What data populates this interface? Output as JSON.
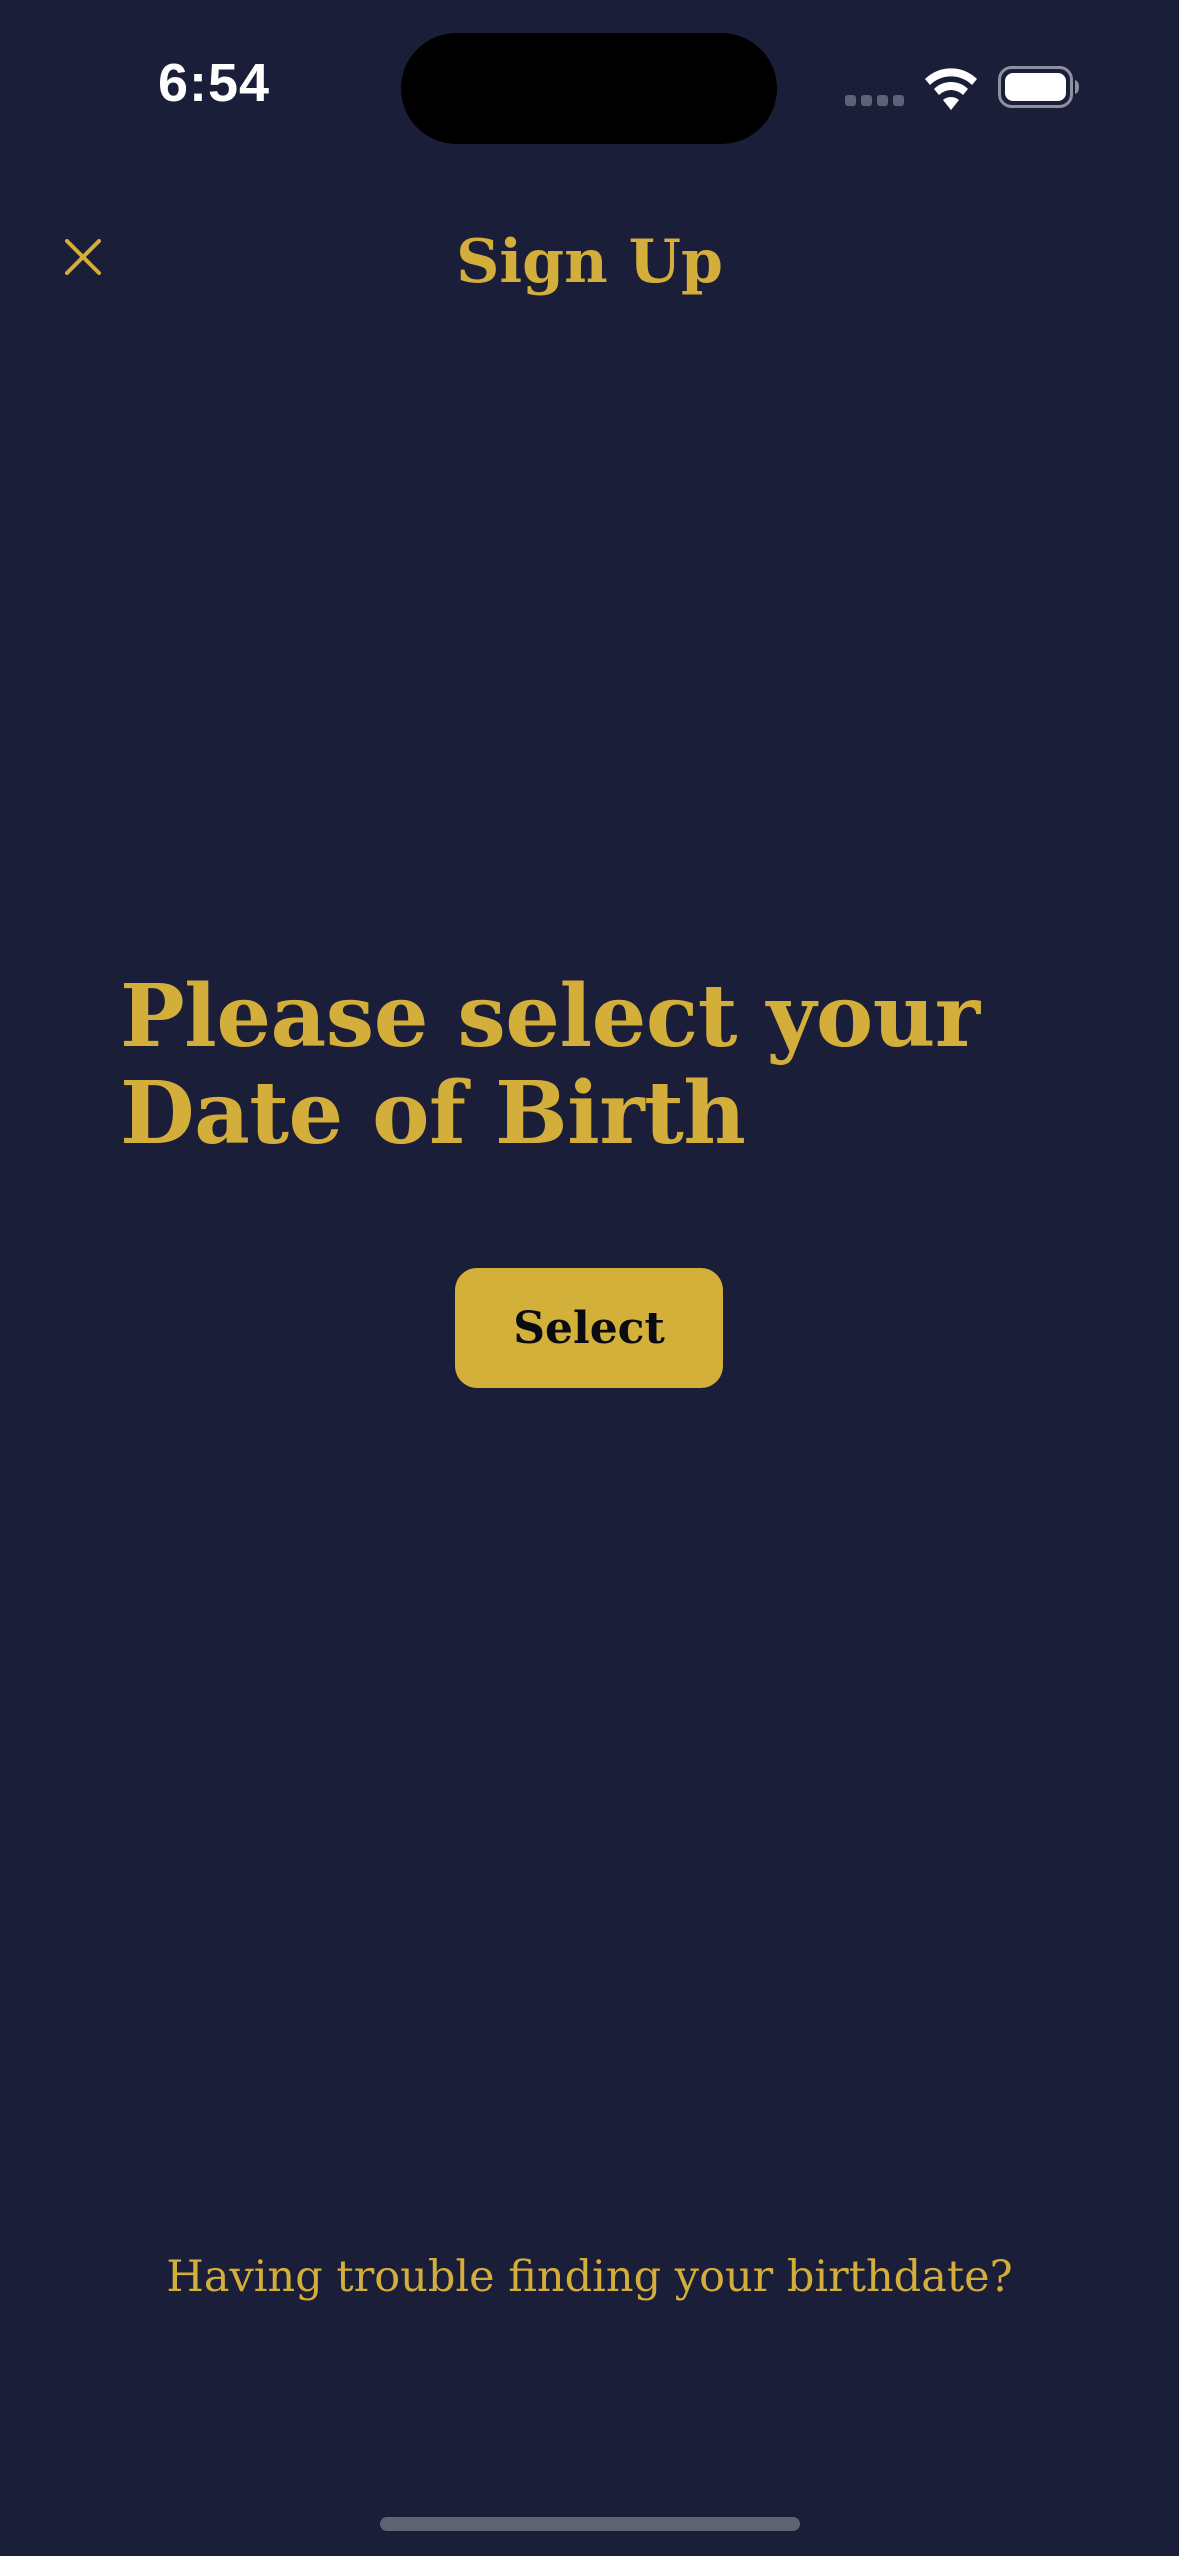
{
  "status_bar": {
    "time": "6:54",
    "icons": [
      "cellular-signal-icon",
      "wifi-icon",
      "battery-icon"
    ]
  },
  "nav": {
    "title": "Sign Up",
    "close_icon": "close-icon"
  },
  "main": {
    "heading": "Please select your Date of Birth",
    "select_button_label": "Select"
  },
  "footer": {
    "help_link": "Having trouble finding your birthdate?"
  },
  "colors": {
    "background": "#1b1e38",
    "accent_gold": "#d4ae3b",
    "button_fill": "#d3b03a",
    "button_text": "#0a0a12"
  }
}
